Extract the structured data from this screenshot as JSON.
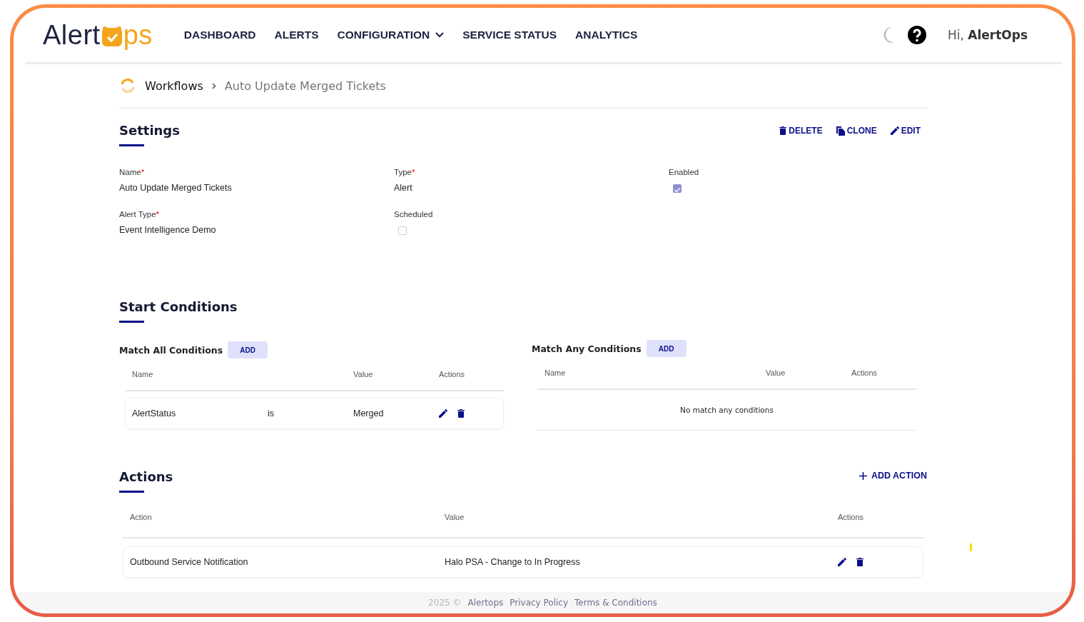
{
  "header": {
    "logo": {
      "text_before": "Alert",
      "text_after": "ps"
    },
    "nav": [
      {
        "label": "DASHBOARD",
        "has_menu": false
      },
      {
        "label": "ALERTS",
        "has_menu": false
      },
      {
        "label": "CONFIGURATION",
        "has_menu": true
      },
      {
        "label": "SERVICE STATUS",
        "has_menu": false
      },
      {
        "label": "ANALYTICS",
        "has_menu": false
      }
    ],
    "greeting": "Hi, **AlertOps**"
  },
  "breadcrumb": [
    "Workflows",
    "Auto Update Merged Tickets"
  ],
  "settings": {
    "title": "Settings",
    "buttons": [
      {
        "label": "DELETE",
        "kind": "delete"
      },
      {
        "label": "CLONE",
        "kind": "clone"
      },
      {
        "label": "EDIT",
        "kind": "edit"
      }
    ],
    "rows": [
      [
        {
          "label": "Name",
          "required_mark": "*",
          "kind": "text",
          "value": "Auto Update Merged Tickets"
        },
        {
          "label": "Type",
          "required_mark": "*",
          "kind": "text",
          "value": "Alert"
        },
        {
          "label": "Enabled",
          "kind": "checkbox",
          "checked": true
        }
      ],
      [
        {
          "label": "Alert Type",
          "required_mark": "*",
          "kind": "text",
          "value": "Event Intelligence Demo"
        },
        {
          "label": "Scheduled",
          "kind": "checkbox",
          "checked": false
        }
      ]
    ]
  },
  "start_conditions": {
    "title": "Start Conditions",
    "groups": [
      {
        "title": "Match All Conditions",
        "button": "ADD",
        "columns": [
          "Name",
          "",
          "Value",
          "Actions"
        ],
        "rows": [
          [
            "AlertStatus",
            "is",
            "Merged"
          ]
        ]
      },
      {
        "title": "Match Any Conditions",
        "button": "ADD",
        "columns": [
          "Name",
          "",
          "Value",
          "Actions"
        ],
        "empty_text": "No match any conditions"
      }
    ]
  },
  "actions": {
    "title": "Actions",
    "button": "ADD ACTION",
    "columns": [
      "Action",
      "Value",
      "Actions"
    ],
    "rows": [
      [
        "Outbound Service Notification",
        "Halo PSA - Change to In Progress"
      ]
    ]
  },
  "footer": [
    "2025 ©",
    "Alertops",
    "Privacy Policy",
    "Terms & Conditions"
  ]
}
